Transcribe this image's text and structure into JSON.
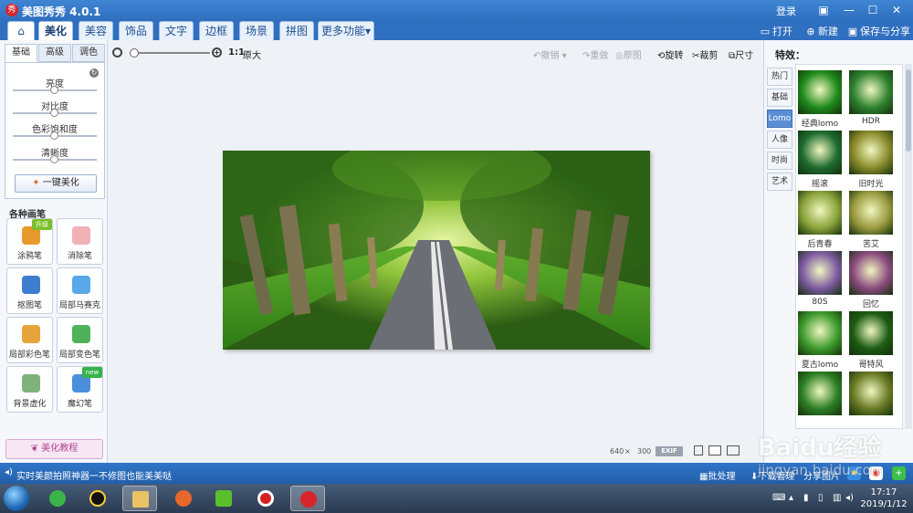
{
  "window": {
    "app_title": "美图秀秀 4.0.1",
    "app_icon_text": "秀",
    "login_label": "登录",
    "controls": {
      "skin": "▣",
      "minimize": "—",
      "maximize": "☐",
      "close": "✕"
    }
  },
  "nav": {
    "home_icon": "⌂",
    "tabs": [
      {
        "label": "美化",
        "active": true
      },
      {
        "label": "美容"
      },
      {
        "label": "饰品"
      },
      {
        "label": "文字"
      },
      {
        "label": "边框"
      },
      {
        "label": "场景"
      },
      {
        "label": "拼图"
      },
      {
        "label": "更多功能▾"
      }
    ],
    "actions": {
      "open": "打开",
      "new": "新建",
      "save_share": "保存与分享"
    }
  },
  "left_panel": {
    "subtabs": [
      "基础",
      "高级",
      "调色"
    ],
    "sliders": [
      {
        "label": "亮度",
        "level": 0.5
      },
      {
        "label": "对比度",
        "level": 0.5
      },
      {
        "label": "色彩饱和度",
        "level": 0.5
      },
      {
        "label": "清晰度",
        "level": 0.5
      }
    ],
    "one_click_label": "一键美化",
    "brushes_title": "各种画笔",
    "tools": [
      {
        "label": "涂鸦笔",
        "badge": "升级",
        "color": "#e79a2c",
        "badge_color": "#7bbf2a"
      },
      {
        "label": "消除笔",
        "color": "#f0b1b7"
      },
      {
        "label": "抠图笔",
        "color": "#3c7dd0"
      },
      {
        "label": "局部马赛克",
        "color": "#59a8e8"
      },
      {
        "label": "局部彩色笔",
        "color": "#e7a43b"
      },
      {
        "label": "局部变色笔",
        "color": "#4fb25a"
      },
      {
        "label": "背景虚化",
        "color": "#7fb37b"
      },
      {
        "label": "魔幻笔",
        "badge": "new",
        "color": "#4a8fdc",
        "badge_color": "#35b34a"
      }
    ],
    "tutorial_label": "美化教程"
  },
  "toolbar": {
    "ratio_label": "1:1",
    "original_label": "原大",
    "undo_label": "撤销",
    "redo_label": "重做",
    "original_image_label": "原图",
    "rotate_label": "旋转",
    "crop_label": "裁剪",
    "size_label": "尺寸",
    "zoom_level": 0.04
  },
  "canvas": {
    "img_width": "640",
    "times": "×",
    "img_height": "300",
    "exif_label": "EXIF"
  },
  "right_panel": {
    "title": "特效：",
    "categories": [
      {
        "label": "热门"
      },
      {
        "label": "基础"
      },
      {
        "label": "Lomo",
        "active": true
      },
      {
        "label": "人像"
      },
      {
        "label": "时尚"
      },
      {
        "label": "艺术"
      }
    ],
    "effects": [
      {
        "label": "经典lomo",
        "tint": "#1f8a1b"
      },
      {
        "label": "HDR",
        "tint": "#2f8230"
      },
      {
        "label": "摇滚",
        "tint": "#1e6b2f"
      },
      {
        "label": "旧时光",
        "tint": "#8a8a2a"
      },
      {
        "label": "后青春",
        "tint": "#8aa33a"
      },
      {
        "label": "苦艾",
        "tint": "#9a9a3f"
      },
      {
        "label": "80S",
        "tint": "#7d5aa0"
      },
      {
        "label": "回忆",
        "tint": "#8b4a7e"
      },
      {
        "label": "夏古lomo",
        "tint": "#3e9a2c"
      },
      {
        "label": "哥特风",
        "tint": "#1c5c14"
      },
      {
        "label": "",
        "tint": "#2c7f24"
      },
      {
        "label": "",
        "tint": "#6a7a24"
      }
    ]
  },
  "statusbar": {
    "text": "实时美颜拍照神器一不修图也能美美哒",
    "batch_label": "批处理",
    "download_label": "下载管理",
    "share_label": "分享图片"
  },
  "taskbar": {
    "time": "17:17",
    "date": "2019/1/12"
  },
  "watermark": {
    "text": "Baidu经验",
    "url": "jingyan.baidu.com"
  }
}
